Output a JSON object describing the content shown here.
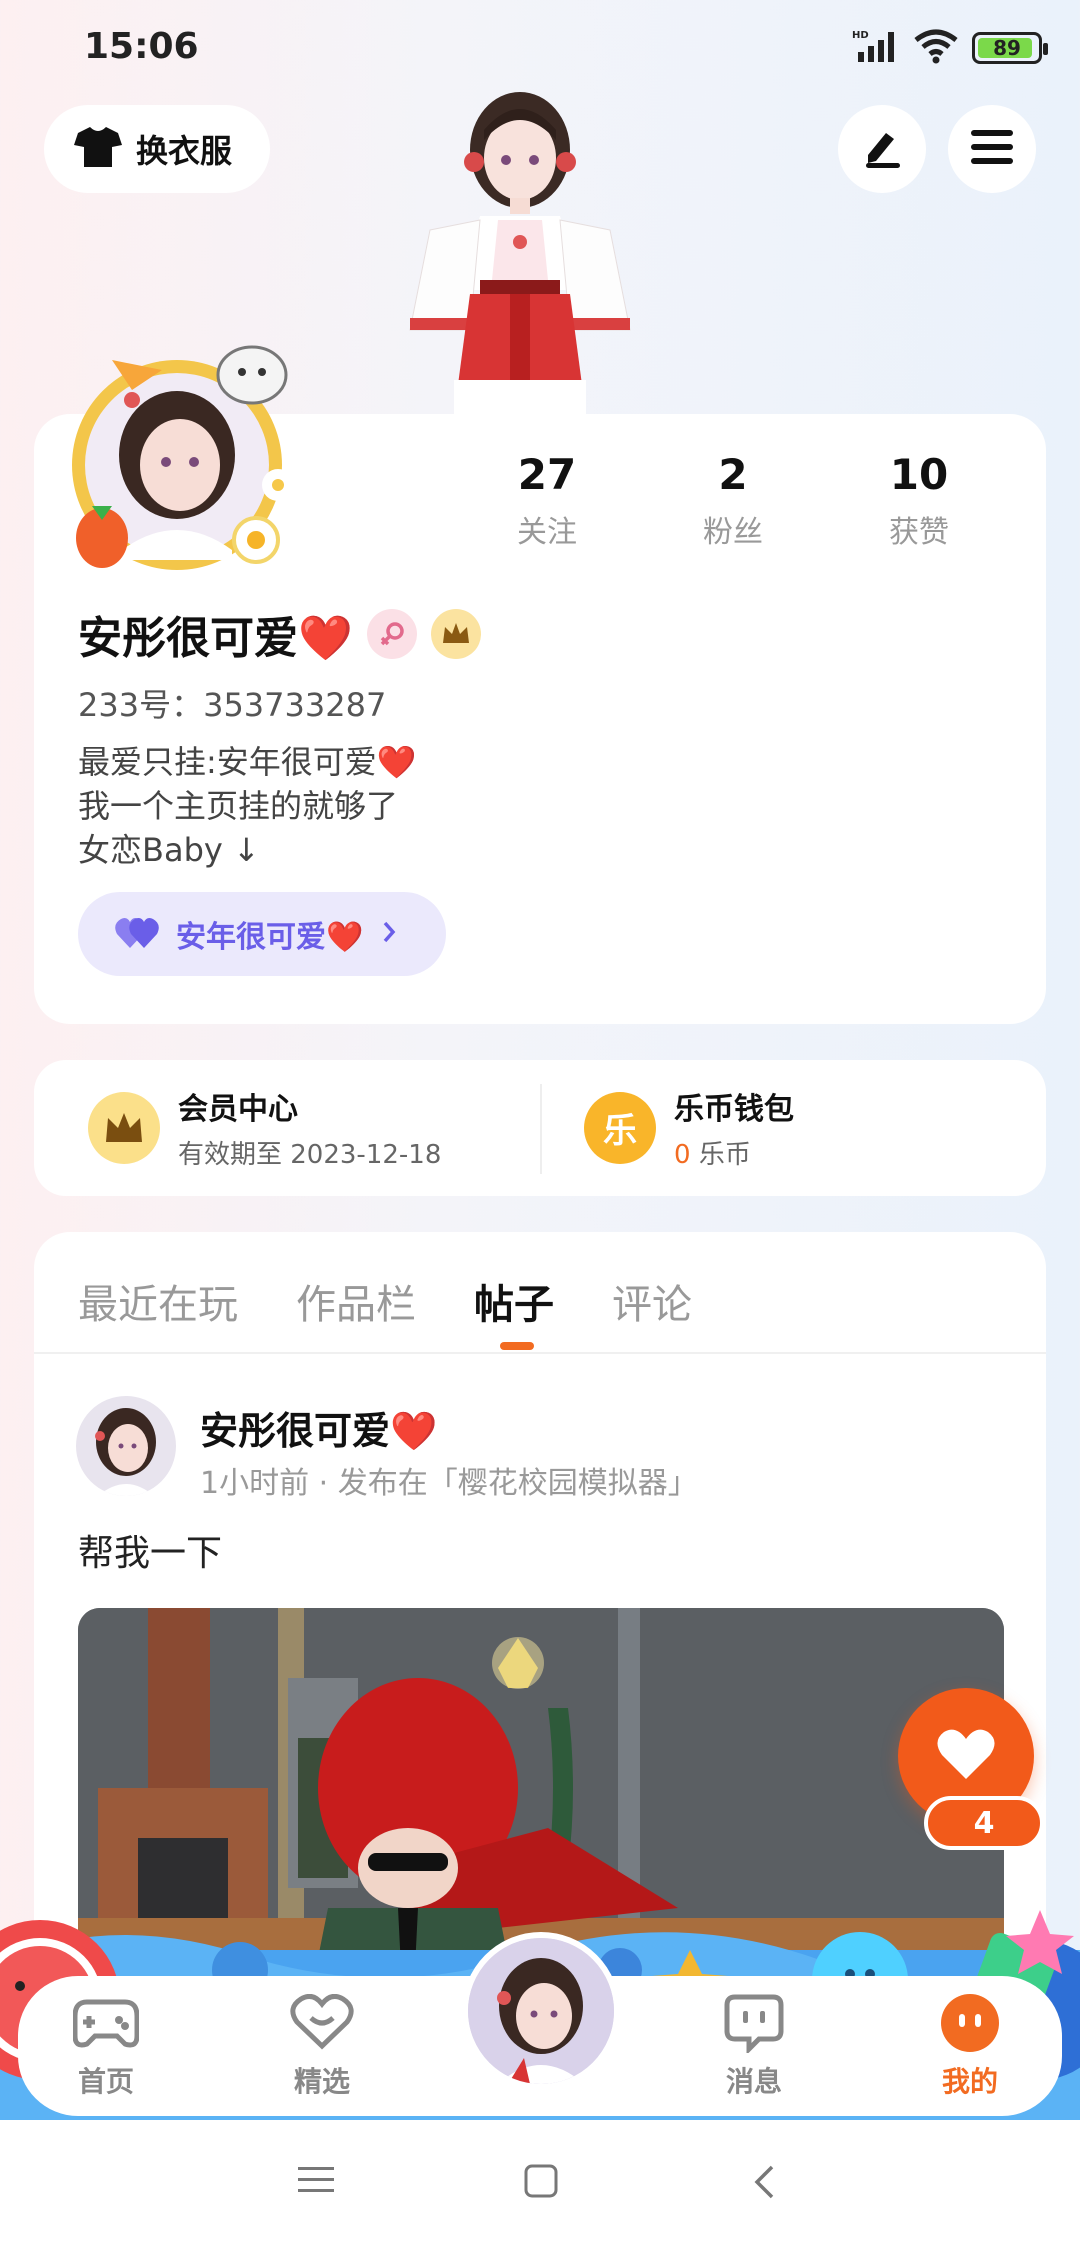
{
  "status": {
    "time": "15:06",
    "battery": "89",
    "network": "HD"
  },
  "header": {
    "outfit_label": "换衣服"
  },
  "profile": {
    "stats": [
      {
        "value": "27",
        "label": "关注"
      },
      {
        "value": "2",
        "label": "粉丝"
      },
      {
        "value": "10",
        "label": "获赞"
      }
    ],
    "username": "安彤很可爱❤️",
    "user_id": "233号：353733287",
    "bio_lines": [
      "最爱只挂:安年很可爱❤️",
      "我一个主页挂的就够了",
      "女恋Baby ↓"
    ],
    "link_label": "安年很可爱❤️"
  },
  "wallet": {
    "member_title": "会员中心",
    "member_sub": "有效期至 2023-12-18",
    "coin_title": "乐币钱包",
    "coin_amount": "0",
    "coin_unit": "乐币",
    "coin_glyph": "乐"
  },
  "tabs": [
    {
      "label": "最近在玩",
      "active": false
    },
    {
      "label": "作品栏",
      "active": false
    },
    {
      "label": "帖子",
      "active": true
    },
    {
      "label": "评论",
      "active": false
    }
  ],
  "post": {
    "author": "安彤很可爱❤️",
    "meta": "1小时前 · 发布在「樱花校园模拟器」",
    "text": "帮我一下"
  },
  "like": {
    "count": "4"
  },
  "nav": {
    "items": [
      {
        "label": "首页",
        "active": false
      },
      {
        "label": "精选",
        "active": false
      },
      {
        "label": "消息",
        "active": false
      },
      {
        "label": "我的",
        "active": true
      }
    ]
  },
  "colors": {
    "accent": "#f26b21",
    "like": "#f25a1a",
    "link": "#6a5ee8"
  }
}
